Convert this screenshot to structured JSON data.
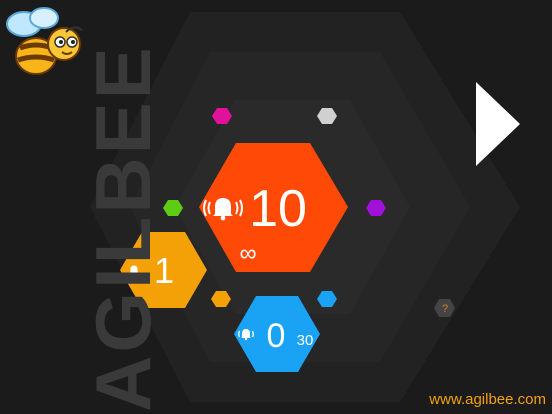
{
  "brand": {
    "vertical_text": "AGILBEE",
    "url": "www.agilbee.com"
  },
  "main_hex": {
    "value": "10",
    "mode_symbol": "∞",
    "color": "#ff4a07"
  },
  "left_hex": {
    "value": "1",
    "color": "#f4a007"
  },
  "bottom_hex": {
    "value": "0",
    "sub_value": "30",
    "color": "#1aa3f4"
  },
  "dots": [
    {
      "name": "magenta-dot",
      "color": "#e0129a"
    },
    {
      "name": "gray-dot",
      "color": "#d0d0d0"
    },
    {
      "name": "green-dot",
      "color": "#5ccc14"
    },
    {
      "name": "purple-dot",
      "color": "#a010d8"
    },
    {
      "name": "orange-dot",
      "color": "#f4a007"
    },
    {
      "name": "blue-dot",
      "color": "#1aa3f4"
    }
  ],
  "help": {
    "label": "?"
  },
  "icons": {
    "alarm": "alarm-bell-icon",
    "play": "play-icon",
    "logo": "bee-logo-icon"
  }
}
